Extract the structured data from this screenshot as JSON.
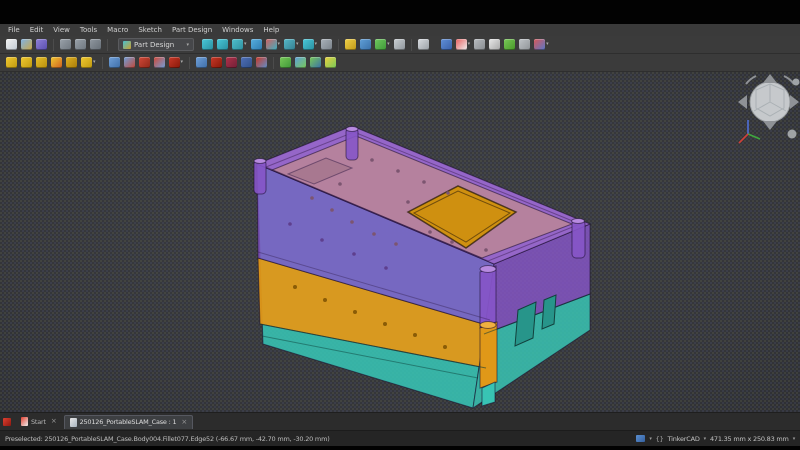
{
  "menu_bar": {
    "items": [
      "File",
      "Edit",
      "View",
      "Tools",
      "Macro",
      "Sketch",
      "Part Design",
      "Windows",
      "Help"
    ]
  },
  "toolbar_main": {
    "workbench_selector": {
      "value": "Part Design"
    },
    "file_icons": [
      {
        "name": "new-document-icon",
        "colors": [
          "#f2f2f2",
          "#c2cbd4"
        ]
      },
      {
        "name": "open-document-icon",
        "colors": [
          "#7fb2e5",
          "#caa84a"
        ]
      },
      {
        "name": "save-icon",
        "colors": [
          "#8f7fd8",
          "#5a4fae"
        ]
      },
      {
        "sep": true
      },
      {
        "name": "undo-icon",
        "colors": [
          "#9aa2aa",
          "#6f777f"
        ]
      },
      {
        "name": "redo-icon",
        "colors": [
          "#9aa2aa",
          "#6f777f"
        ]
      },
      {
        "name": "refresh-icon",
        "colors": [
          "#8f979f",
          "#666e76"
        ]
      },
      {
        "sep": true
      }
    ],
    "view_icons": [
      {
        "name": "fit-all-icon",
        "colors": [
          "#49c8d8",
          "#2a8fa0"
        ]
      },
      {
        "name": "fit-selection-icon",
        "colors": [
          "#49c8d8",
          "#2a8fa0"
        ]
      },
      {
        "name": "draw-style-icon",
        "colors": [
          "#4fc0cc",
          "#2f90a0"
        ],
        "dd": true
      },
      {
        "name": "selection-view-icon",
        "colors": [
          "#56aede",
          "#2f7cb0"
        ]
      },
      {
        "name": "clipping-plane-icon",
        "colors": [
          "#d06060",
          "#3fb0c0"
        ],
        "dd": true
      },
      {
        "name": "axonometric-view-icon",
        "colors": [
          "#55b8c8",
          "#357f90"
        ],
        "dd": true
      },
      {
        "name": "zoom-icon",
        "colors": [
          "#49c8d8",
          "#2a8fa0"
        ],
        "dd": true
      },
      {
        "name": "measure-icon",
        "colors": [
          "#aab2ba",
          "#7a828a"
        ]
      },
      {
        "sep": true
      },
      {
        "name": "appearance-icon",
        "colors": [
          "#f0d048",
          "#c09a18"
        ]
      },
      {
        "name": "texture-icon",
        "colors": [
          "#5f9fd8",
          "#3a70a8"
        ]
      },
      {
        "name": "link-icon",
        "colors": [
          "#6fc85f",
          "#3f9838"
        ],
        "dd": true
      },
      {
        "name": "expression-braces-icon",
        "colors": [
          "#c9ced2",
          "#8f969c"
        ]
      },
      {
        "sep": true
      },
      {
        "name": "whatsthis-cursor-icon",
        "colors": [
          "#d8dce0",
          "#9aa0a6"
        ]
      }
    ],
    "misc_icons": [
      {
        "name": "droplet-icon",
        "colors": [
          "#5f8fd8",
          "#3a60a8"
        ]
      },
      {
        "name": "checkerboard-icon",
        "colors": [
          "#e86060",
          "#f0f0f0"
        ],
        "dd": true
      },
      {
        "name": "grid-icon",
        "colors": [
          "#b8bcc0",
          "#888c90"
        ]
      },
      {
        "name": "chess-knight-icon",
        "colors": [
          "#e8e8e8",
          "#a8a8a8"
        ]
      },
      {
        "name": "puzzle-icon",
        "colors": [
          "#78c858",
          "#489828"
        ]
      },
      {
        "name": "sphere-icon",
        "colors": [
          "#c0c4c8",
          "#909498"
        ]
      },
      {
        "name": "axis-cross-icon",
        "colors": [
          "#d85858",
          "#5878c8"
        ],
        "dd": true
      }
    ]
  },
  "toolbar_partdesign": {
    "icons": [
      {
        "name": "datum-point-icon",
        "colors": [
          "#f0c830",
          "#c09a10"
        ]
      },
      {
        "name": "datum-line-icon",
        "colors": [
          "#f0c830",
          "#c09a10"
        ]
      },
      {
        "name": "datum-plane-icon",
        "colors": [
          "#e8be28",
          "#b8900e"
        ]
      },
      {
        "name": "coordinate-system-icon",
        "colors": [
          "#f0c830",
          "#d06020"
        ]
      },
      {
        "name": "shape-binder-icon",
        "colors": [
          "#e0b020",
          "#a87c0a"
        ]
      },
      {
        "name": "clone-icon",
        "colors": [
          "#f0c830",
          "#c09a10"
        ],
        "dd": true
      },
      {
        "sep": true
      },
      {
        "name": "create-body-icon",
        "colors": [
          "#6f9fd8",
          "#3f6fa8"
        ]
      },
      {
        "name": "create-sketch-icon",
        "colors": [
          "#6f9fd8",
          "#c04838"
        ]
      },
      {
        "name": "edit-sketch-icon",
        "colors": [
          "#d04838",
          "#902818"
        ]
      },
      {
        "name": "map-sketch-icon",
        "colors": [
          "#d04838",
          "#6f9fd8"
        ]
      },
      {
        "name": "pad-icon",
        "colors": [
          "#c83828",
          "#881808"
        ],
        "dd": true
      },
      {
        "sep": true
      },
      {
        "name": "revolve-icon",
        "colors": [
          "#6f9fd8",
          "#3f6fa8"
        ]
      },
      {
        "name": "pocket-icon",
        "colors": [
          "#c83828",
          "#881808"
        ]
      },
      {
        "name": "hole-icon",
        "colors": [
          "#b03048",
          "#702038"
        ]
      },
      {
        "name": "groove-icon",
        "colors": [
          "#4f6fb8",
          "#2f4f88"
        ]
      },
      {
        "name": "loft-icon",
        "colors": [
          "#c83828",
          "#5f8fc8"
        ]
      },
      {
        "sep": true
      },
      {
        "name": "fillet-icon",
        "colors": [
          "#78c858",
          "#3f9838"
        ]
      },
      {
        "name": "chamfer-icon",
        "colors": [
          "#5f9fd8",
          "#78c858"
        ]
      },
      {
        "name": "draft-icon",
        "colors": [
          "#78c858",
          "#3a70a8"
        ]
      },
      {
        "name": "boolean-icon",
        "colors": [
          "#e8d040",
          "#78c858"
        ]
      }
    ]
  },
  "viewport": {
    "model": {
      "description": "Layered electronics case: translucent purple lid, orange mid frame, teal bottom shell, orange display window",
      "colors": {
        "lid": "#8655c8",
        "lid_top": "#9a68d0",
        "plate": "#b5819e",
        "mid": "#e09818",
        "bottom": "#38c4b4",
        "window": "#cf9010"
      }
    }
  },
  "tab_bar": {
    "tabs": [
      {
        "label": "Start"
      },
      {
        "label": "250126_PortableSLAM_Case : 1"
      }
    ]
  },
  "status_bar": {
    "message": "Preselected: 250126_PortableSLAM_Case.Body004.Fillet077.Edge52 (-66.67 mm, -42.70 mm, -30.20 mm)",
    "navigation_style": "TinkerCAD",
    "dimensions": "471.35 mm x 250.83 mm"
  }
}
